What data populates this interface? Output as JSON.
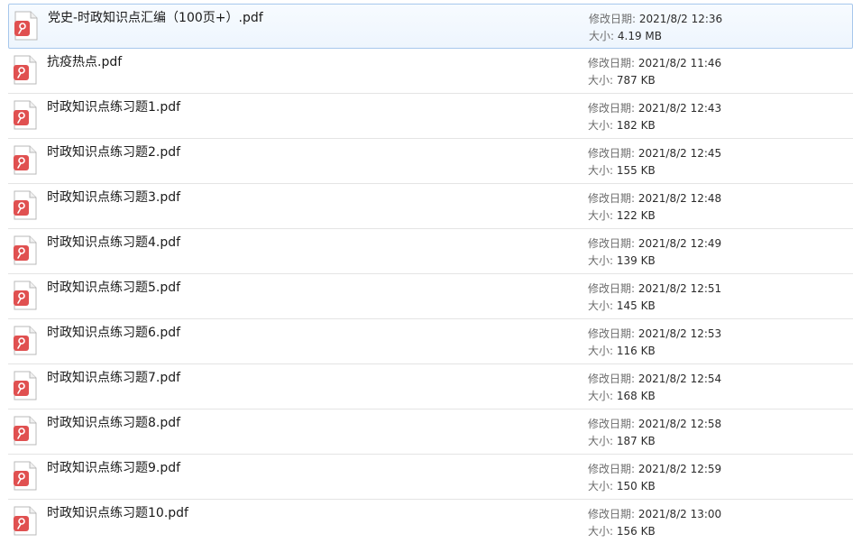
{
  "labels": {
    "modified": "修改日期:",
    "size": "大小:"
  },
  "colors": {
    "pdf_badge": "#e05050",
    "selected_border": "#a7c7ec"
  },
  "files": [
    {
      "name": "党史-时政知识点汇编（100页+）.pdf",
      "modified": "2021/8/2 12:36",
      "size": "4.19 MB",
      "icon": "pdf-file-icon",
      "selected": true
    },
    {
      "name": "抗疫热点.pdf",
      "modified": "2021/8/2 11:46",
      "size": "787 KB",
      "icon": "pdf-file-icon"
    },
    {
      "name": "时政知识点练习题1.pdf",
      "modified": "2021/8/2 12:43",
      "size": "182 KB",
      "icon": "pdf-file-icon"
    },
    {
      "name": "时政知识点练习题2.pdf",
      "modified": "2021/8/2 12:45",
      "size": "155 KB",
      "icon": "pdf-file-icon"
    },
    {
      "name": "时政知识点练习题3.pdf",
      "modified": "2021/8/2 12:48",
      "size": "122 KB",
      "icon": "pdf-file-icon"
    },
    {
      "name": "时政知识点练习题4.pdf",
      "modified": "2021/8/2 12:49",
      "size": "139 KB",
      "icon": "pdf-file-icon"
    },
    {
      "name": "时政知识点练习题5.pdf",
      "modified": "2021/8/2 12:51",
      "size": "145 KB",
      "icon": "pdf-file-icon"
    },
    {
      "name": "时政知识点练习题6.pdf",
      "modified": "2021/8/2 12:53",
      "size": "116 KB",
      "icon": "pdf-file-icon"
    },
    {
      "name": "时政知识点练习题7.pdf",
      "modified": "2021/8/2 12:54",
      "size": "168 KB",
      "icon": "pdf-file-icon"
    },
    {
      "name": "时政知识点练习题8.pdf",
      "modified": "2021/8/2 12:58",
      "size": "187 KB",
      "icon": "pdf-file-icon"
    },
    {
      "name": "时政知识点练习题9.pdf",
      "modified": "2021/8/2 12:59",
      "size": "150 KB",
      "icon": "pdf-file-icon"
    },
    {
      "name": "时政知识点练习题10.pdf",
      "modified": "2021/8/2 13:00",
      "size": "156 KB",
      "icon": "pdf-file-icon"
    }
  ]
}
